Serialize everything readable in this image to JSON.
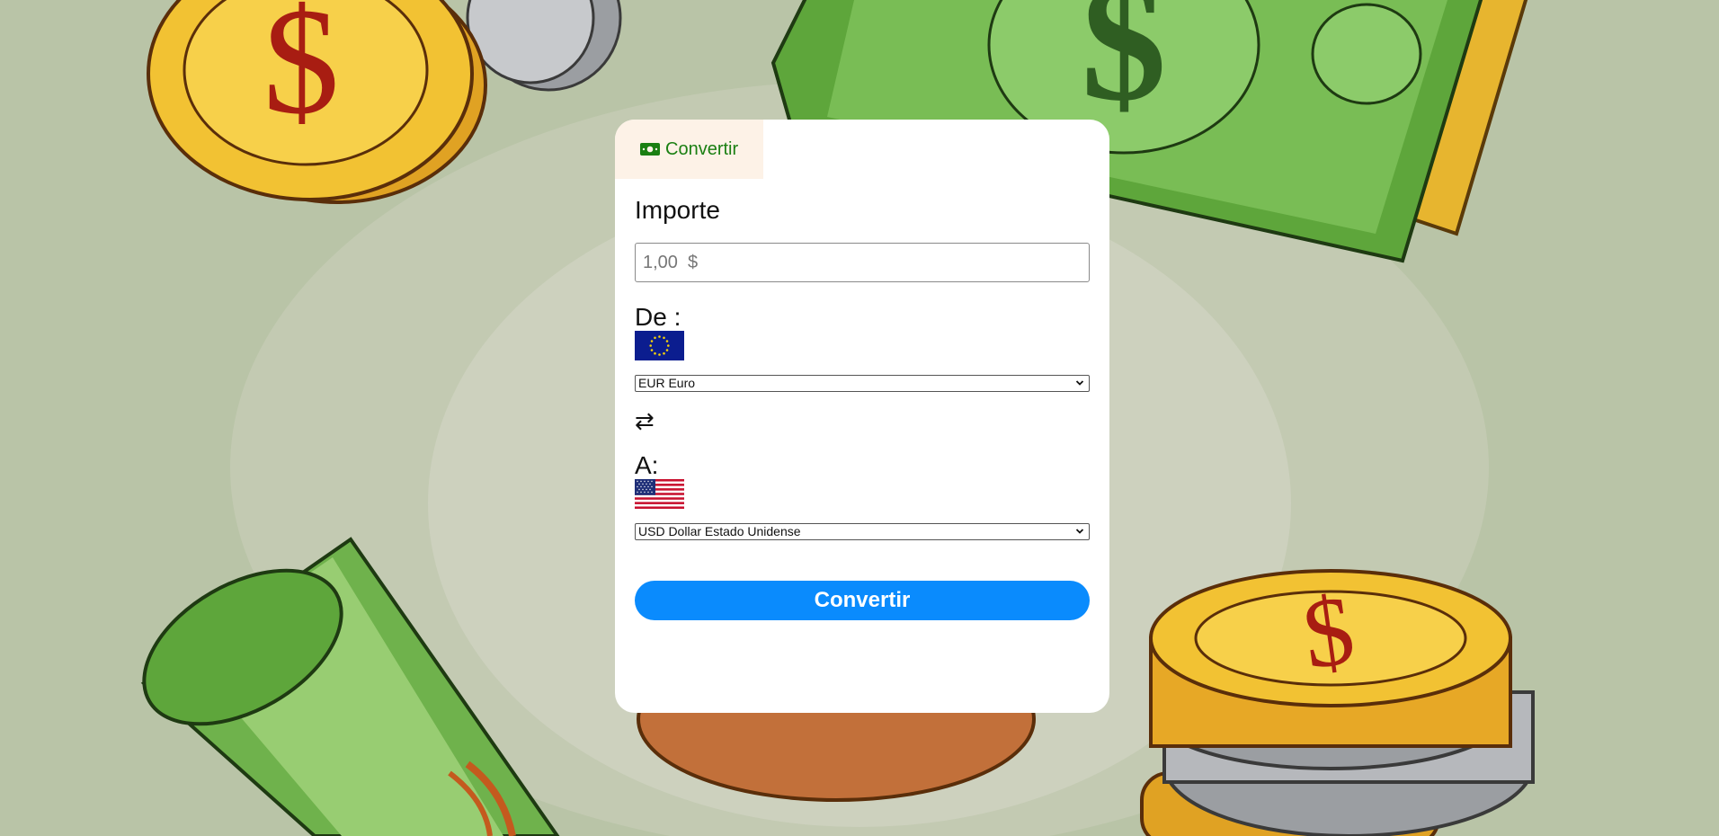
{
  "tab": {
    "label": "Convertir",
    "icon": "banknote-icon"
  },
  "amount": {
    "label": "Importe",
    "placeholder": "1,00  $"
  },
  "from": {
    "label": "De :",
    "flag": "eu-flag-icon",
    "selected": "EUR Euro"
  },
  "swap": {
    "icon": "swap-arrows-icon",
    "glyph": "⇄"
  },
  "to": {
    "label": "A:",
    "flag": "us-flag-icon",
    "selected": "USD Dollar Estado Unidense"
  },
  "convert_button": {
    "label": "Convertir"
  },
  "colors": {
    "accent": "#0a8bfd",
    "tab_text": "#1a7f12",
    "tab_bg": "#fdf2e7",
    "background": "#b9c4a7"
  }
}
